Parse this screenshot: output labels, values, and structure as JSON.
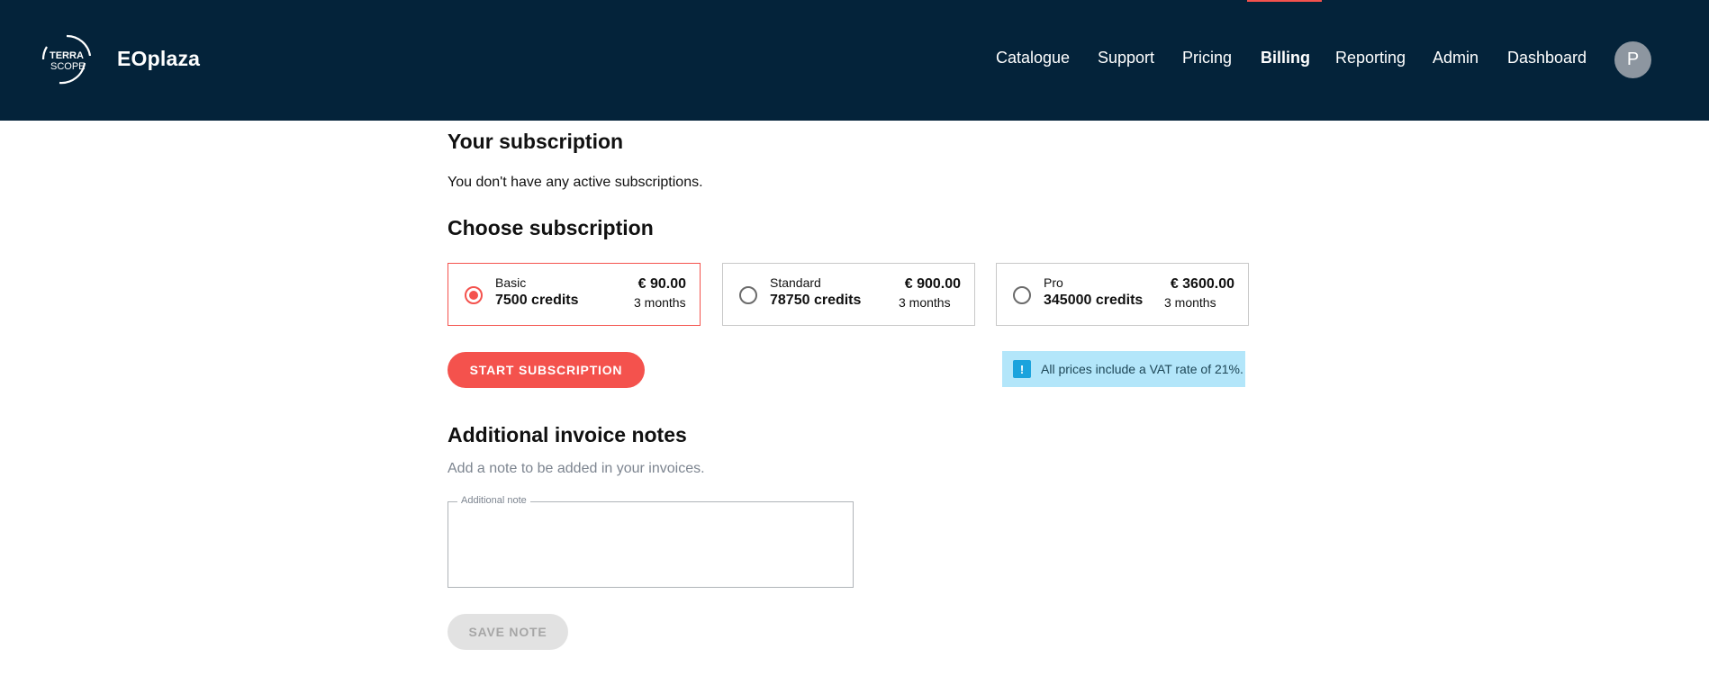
{
  "header": {
    "logo_text": [
      "TERRA",
      "SCOPE"
    ],
    "brand": "EOplaza",
    "nav": [
      {
        "label": "Catalogue",
        "active": false
      },
      {
        "label": "Support",
        "active": false
      },
      {
        "label": "Pricing",
        "active": false
      },
      {
        "label": "Billing",
        "active": true
      },
      {
        "label": "Reporting",
        "active": false
      },
      {
        "label": "Admin",
        "active": false
      },
      {
        "label": "Dashboard",
        "active": false
      }
    ],
    "avatar_initial": "P"
  },
  "subscription": {
    "title": "Your subscription",
    "status_text": "You don't have any active subscriptions."
  },
  "choose": {
    "title": "Choose subscription",
    "plans": [
      {
        "name": "Basic",
        "credits": "7500 credits",
        "price": "€ 90.00",
        "duration": "3 months",
        "selected": true
      },
      {
        "name": "Standard",
        "credits": "78750 credits",
        "price": "€ 900.00",
        "duration": "3 months",
        "selected": false
      },
      {
        "name": "Pro",
        "credits": "345000 credits",
        "price": "€ 3600.00",
        "duration": "3 months",
        "selected": false
      }
    ],
    "start_button": "START SUBSCRIPTION",
    "vat_note": "All prices include a VAT rate of 21%.",
    "vat_icon": "info-icon"
  },
  "notes": {
    "title": "Additional invoice notes",
    "description": "Add a note to be added in your invoices.",
    "field_label": "Additional note",
    "field_value": "",
    "save_button": "SAVE NOTE"
  },
  "colors": {
    "header_bg": "#04233a",
    "accent": "#f4524d",
    "info_bg": "#b3e6fa",
    "info_icon": "#1ba3dd"
  }
}
